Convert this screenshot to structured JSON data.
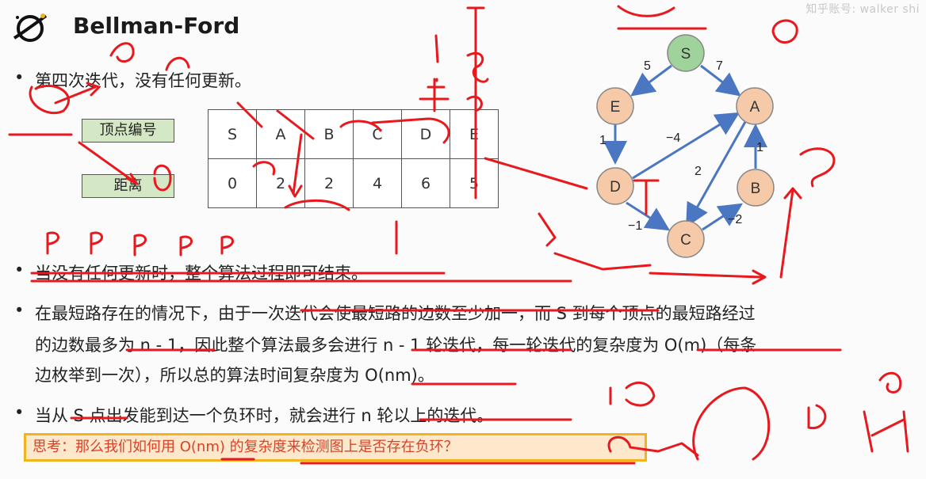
{
  "watermark": "知乎账号: walker shi",
  "title": "Bellman-Ford",
  "bullet1": "第四次迭代，没有任何更新。",
  "labels": {
    "vertex": "顶点编号",
    "distance": "距离"
  },
  "table": {
    "vertices": [
      "S",
      "A",
      "B",
      "C",
      "D",
      "E"
    ],
    "distances": [
      "0",
      "2",
      "2",
      "4",
      "6",
      "5"
    ]
  },
  "graph": {
    "nodes": [
      "S",
      "E",
      "A",
      "D",
      "B",
      "C"
    ],
    "edge_weights": [
      "5",
      "7",
      "1",
      "−4",
      "2",
      "1",
      "−1",
      "−2"
    ]
  },
  "bullet2": "当没有任何更新时，整个算法过程即可结束。",
  "bullet3": {
    "line1": "在最短路存在的情况下，由于一次迭代会使最短路的边数至少加一，而 S 到每个顶点的最短路经过",
    "line2": "的边数最多为 n - 1，因此整个算法最多会进行 n - 1 轮迭代，每一轮迭代的复杂度为 O(m)（每条",
    "line3": "边枚举到一次），所以总的算法时间复杂度为 O(nm)。"
  },
  "bullet4": "当从 S 点出发能到达一个负环时，就会进行 n 轮以上的迭代。",
  "think": "思考：那么我们如何用 O(nm) 的复杂度来检测图上是否存在负环？",
  "colors": {
    "node_green": "#9fd39b",
    "node_orange": "#f6c9a8",
    "edge_blue": "#4a76c2",
    "ink_red": "#e8191e",
    "highlight": "#f2b41e"
  }
}
